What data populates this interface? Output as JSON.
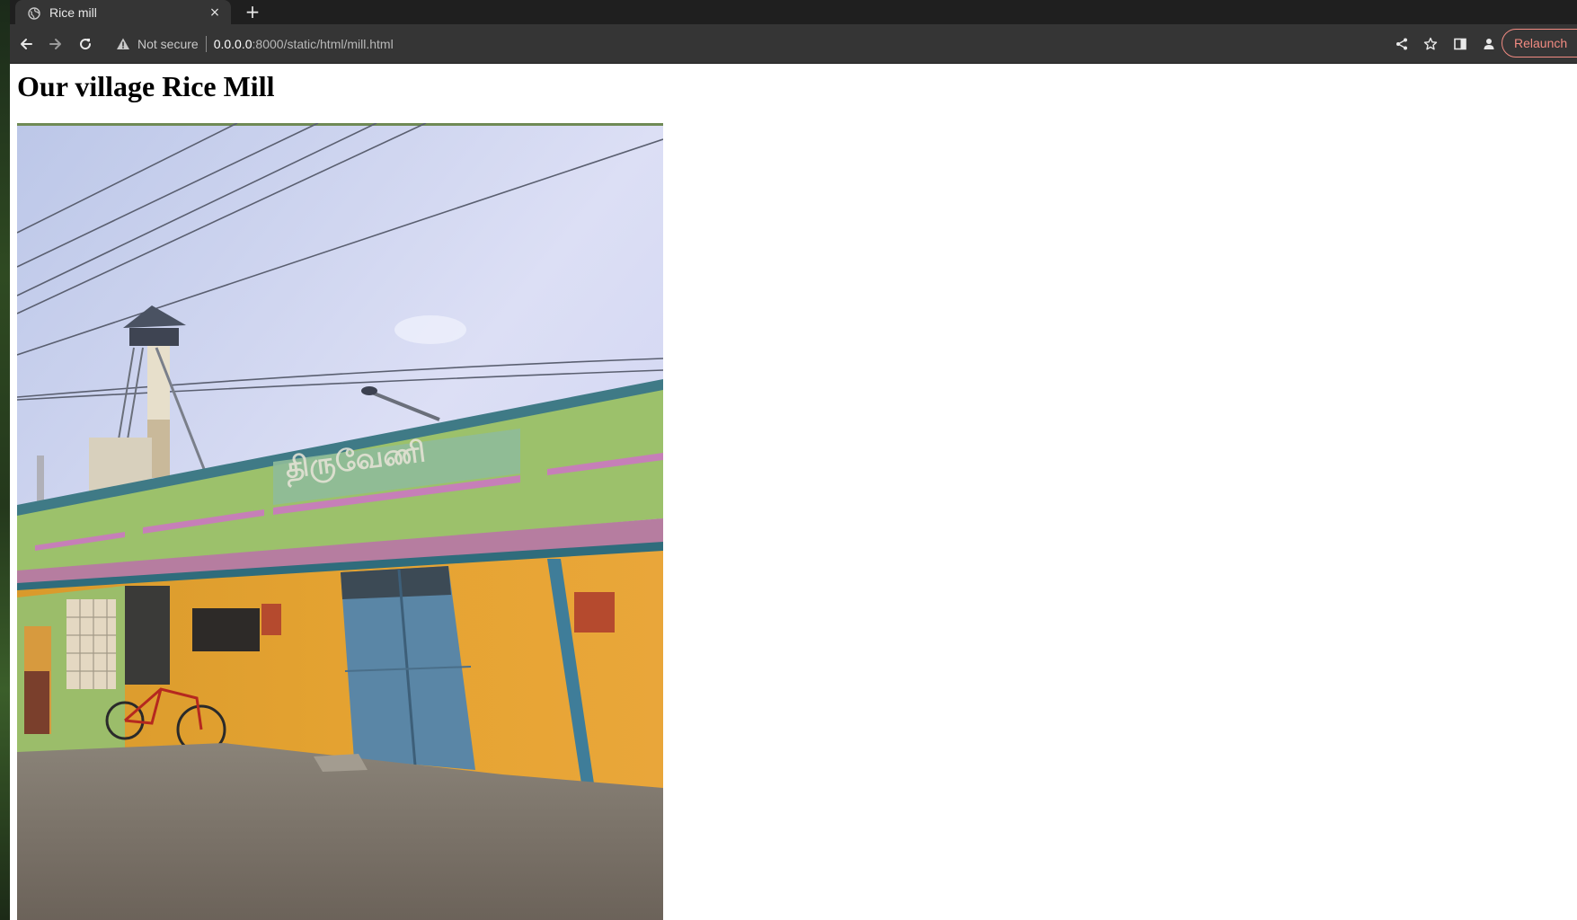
{
  "browser": {
    "tab": {
      "title": "Rice mill",
      "close_label": "×"
    },
    "new_tab_label": "+",
    "toolbar": {
      "security_label": "Not secure",
      "url_host": "0.0.0.0",
      "url_rest": ":8000/static/html/mill.html",
      "relaunch_label": "Relaunch"
    }
  },
  "page": {
    "heading": "Our village Rice Mill",
    "photo": {
      "alt": "Rice mill building",
      "sign_text": "திருவேணி"
    }
  },
  "colors": {
    "tab_strip": "#1f1f1f",
    "toolbar": "#353535",
    "relaunch_accent": "#f28b82",
    "wall_orange": "#e5a02e",
    "wall_green": "#9cc16b",
    "door_blue": "#5a86a6"
  }
}
